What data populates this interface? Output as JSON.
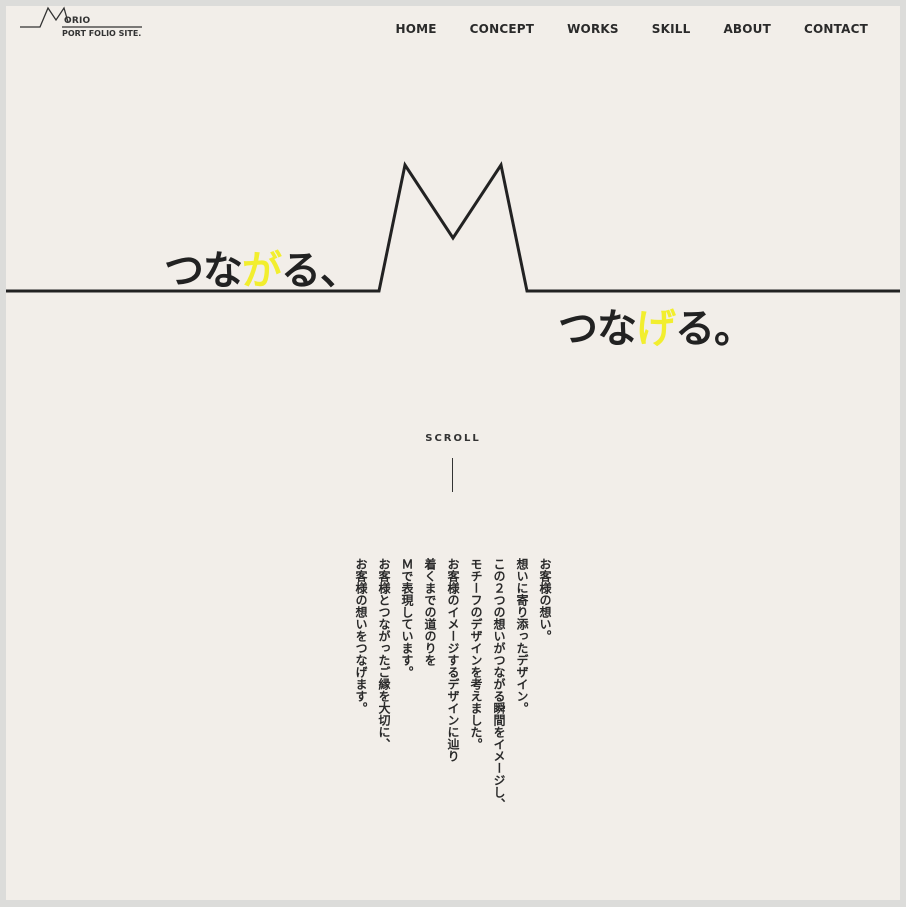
{
  "logo": {
    "line1": "ORIO",
    "line2": "PORT FOLIO SITE."
  },
  "nav": {
    "items": [
      "HOME",
      "CONCEPT",
      "WORKS",
      "SKILL",
      "ABOUT",
      "CONTACT"
    ]
  },
  "hero": {
    "tagline1": {
      "before": "つな",
      "highlight": "が",
      "after": "る、"
    },
    "tagline2": {
      "before": "つな",
      "highlight": "げ",
      "after": "る。"
    },
    "highlight_color": "#f2ee2e"
  },
  "scroll": {
    "label": "SCROLL"
  },
  "concept": {
    "lines": [
      "お客様の想い。",
      "想いに寄り添ったデザイン。",
      "この２つの想いがつながる瞬間をイメージし、",
      "モチーフのデザインを考えました。",
      "お客様のイメージするデザインに辿り",
      "着くまでの道のりを",
      "Ｍで表現しています。",
      "お客様とつながったご縁を大切に、",
      "お客様の想いをつなげます。"
    ]
  },
  "colors": {
    "background": "#f2eee9",
    "text": "#222222",
    "accent": "#f2ee2e"
  }
}
